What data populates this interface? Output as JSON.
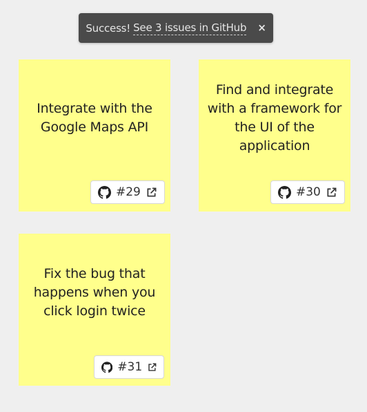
{
  "toast": {
    "prefix": "Success!",
    "link_text": "See 3 issues in GitHub",
    "close_glyph": "×"
  },
  "notes": [
    {
      "text": "Integrate with the Google Maps API",
      "issue_label": "#29",
      "icon": "github-icon",
      "link_icon": "external-link-icon"
    },
    {
      "text": "Find and integrate with a framework for the UI of the application",
      "issue_label": "#30",
      "icon": "github-icon",
      "link_icon": "external-link-icon"
    },
    {
      "text": "Fix the bug that happens when you click login twice",
      "issue_label": "#31",
      "icon": "github-icon",
      "link_icon": "external-link-icon"
    }
  ],
  "colors": {
    "background": "#efefef",
    "note": "#ffff8c",
    "toast": "#4a4a4a"
  }
}
